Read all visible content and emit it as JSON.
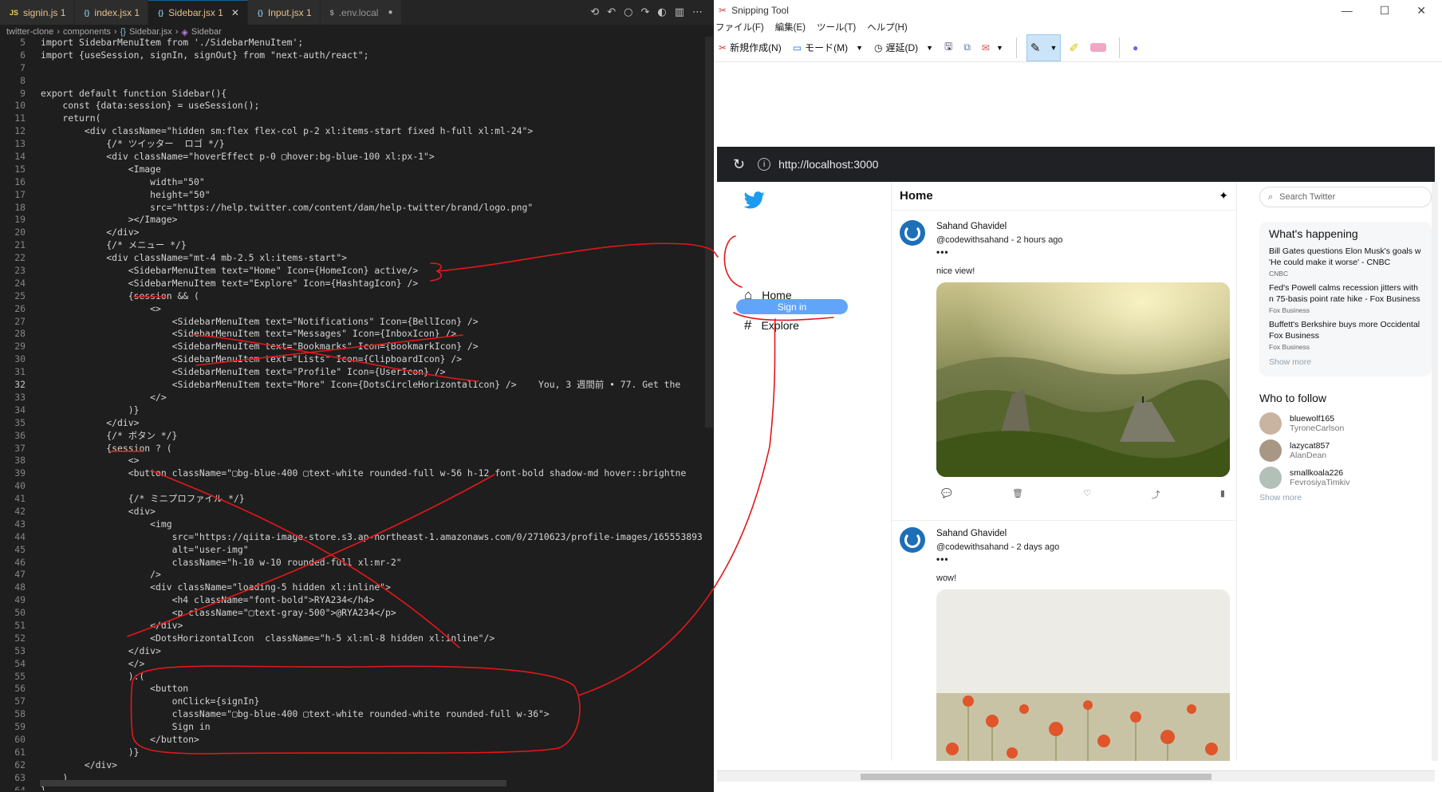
{
  "editor": {
    "tabs": [
      {
        "icon": "JS",
        "label": "signin.js 1"
      },
      {
        "icon": "{}",
        "label": "index.jsx 1"
      },
      {
        "icon": "{}",
        "label": "Sidebar.jsx 1",
        "active": true
      },
      {
        "icon": "{}",
        "label": "Input.jsx 1"
      },
      {
        "icon": "$",
        "label": ".env.local"
      }
    ],
    "breadcrumb": [
      "twitter-clone",
      "components",
      "Sidebar.jsx",
      "Sidebar"
    ],
    "lines": [
      {
        "n": "5",
        "t": "import SidebarMenuItem from './SidebarMenuItem';"
      },
      {
        "n": "6",
        "t": "import {useSession, signIn, signOut} from \"next-auth/react\";"
      },
      {
        "n": "7",
        "t": ""
      },
      {
        "n": "8",
        "t": ""
      },
      {
        "n": "9",
        "t": "export default function Sidebar(){"
      },
      {
        "n": "10",
        "t": "    const {data:session} = useSession();"
      },
      {
        "n": "11",
        "t": "    return("
      },
      {
        "n": "12",
        "t": "        <div className=\"hidden sm:flex flex-col p-2 xl:items-start fixed h-full xl:ml-24\">"
      },
      {
        "n": "13",
        "t": "            {/* ツイッター  ロゴ */}"
      },
      {
        "n": "14",
        "t": "            <div className=\"hoverEffect p-0 ▢hover:bg-blue-100 xl:px-1\">"
      },
      {
        "n": "15",
        "t": "                <Image"
      },
      {
        "n": "16",
        "t": "                    width=\"50\""
      },
      {
        "n": "17",
        "t": "                    height=\"50\""
      },
      {
        "n": "18",
        "t": "                    src=\"https://help.twitter.com/content/dam/help-twitter/brand/logo.png\""
      },
      {
        "n": "19",
        "t": "                ></Image>"
      },
      {
        "n": "20",
        "t": "            </div>"
      },
      {
        "n": "21",
        "t": "            {/* メニュー */}"
      },
      {
        "n": "22",
        "t": "            <div className=\"mt-4 mb-2.5 xl:items-start\">"
      },
      {
        "n": "23",
        "t": "                <SidebarMenuItem text=\"Home\" Icon={HomeIcon} active/>"
      },
      {
        "n": "24",
        "t": "                <SidebarMenuItem text=\"Explore\" Icon={HashtagIcon} />"
      },
      {
        "n": "25",
        "t": "                {session && ("
      },
      {
        "n": "26",
        "t": "                    <>"
      },
      {
        "n": "27",
        "t": "                        <SidebarMenuItem text=\"Notifications\" Icon={BellIcon} />"
      },
      {
        "n": "28",
        "t": "                        <SidebarMenuItem text=\"Messages\" Icon={InboxIcon} />"
      },
      {
        "n": "29",
        "t": "                        <SidebarMenuItem text=\"Bookmarks\" Icon={BookmarkIcon} />"
      },
      {
        "n": "30",
        "t": "                        <SidebarMenuItem text=\"Lists\" Icon={ClipboardIcon} />"
      },
      {
        "n": "31",
        "t": "                        <SidebarMenuItem text=\"Profile\" Icon={UserIcon} />"
      },
      {
        "n": "32",
        "t": "                        <SidebarMenuItem text=\"More\" Icon={DotsCircleHorizontalIcon} />    You, 3 週間前 • 77. Get the"
      },
      {
        "n": "33",
        "t": "                    </>"
      },
      {
        "n": "34",
        "t": "                )}"
      },
      {
        "n": "35",
        "t": "            </div>"
      },
      {
        "n": "36",
        "t": "            {/* ボタン */}"
      },
      {
        "n": "37",
        "t": "            {session ? ("
      },
      {
        "n": "38",
        "t": "                <>"
      },
      {
        "n": "39",
        "t": "                <button className=\"▢bg-blue-400 ▢text-white rounded-full w-56 h-12 font-bold shadow-md hover::brightne"
      },
      {
        "n": "40",
        "t": ""
      },
      {
        "n": "41",
        "t": "                {/* ミニプロファイル */}"
      },
      {
        "n": "42",
        "t": "                <div>"
      },
      {
        "n": "43",
        "t": "                    <img"
      },
      {
        "n": "44",
        "t": "                        src=\"https://qiita-image-store.s3.ap-northeast-1.amazonaws.com/0/2710623/profile-images/165553893"
      },
      {
        "n": "45",
        "t": "                        alt=\"user-img\""
      },
      {
        "n": "46",
        "t": "                        className=\"h-10 w-10 rounded-full xl:mr-2\""
      },
      {
        "n": "47",
        "t": "                    />"
      },
      {
        "n": "48",
        "t": "                    <div className=\"loading-5 hidden xl:inline\">"
      },
      {
        "n": "49",
        "t": "                        <h4 className=\"font-bold\">RYA234</h4>"
      },
      {
        "n": "50",
        "t": "                        <p className=\"▢text-gray-500\">@RYA234</p>"
      },
      {
        "n": "51",
        "t": "                    </div>"
      },
      {
        "n": "52",
        "t": "                    <DotsHorizontalIcon  className=\"h-5 xl:ml-8 hidden xl:inline\"/>"
      },
      {
        "n": "53",
        "t": "                </div>"
      },
      {
        "n": "54",
        "t": "                </>"
      },
      {
        "n": "55",
        "t": "                ):("
      },
      {
        "n": "56",
        "t": "                    <button"
      },
      {
        "n": "57",
        "t": "                        onClick={signIn}"
      },
      {
        "n": "58",
        "t": "                        className=\"▢bg-blue-400 ▢text-white rounded-white rounded-full w-36\">"
      },
      {
        "n": "59",
        "t": "                        Sign in"
      },
      {
        "n": "60",
        "t": "                    </button>"
      },
      {
        "n": "61",
        "t": "                )}"
      },
      {
        "n": "62",
        "t": "        </div>"
      },
      {
        "n": "63",
        "t": "    )"
      },
      {
        "n": "64",
        "t": "}"
      }
    ]
  },
  "snip": {
    "title": "Snipping Tool",
    "menu": [
      "ファイル(F)",
      "編集(E)",
      "ツール(T)",
      "ヘルプ(H)"
    ],
    "new_label": "新規作成(N)",
    "mode_label": "モード(M)",
    "delay_label": "遅延(D)"
  },
  "browser": {
    "url": "http://localhost:3000",
    "nav": [
      {
        "icon": "home-icon",
        "label": "Home"
      },
      {
        "icon": "hashtag-icon",
        "label": "Explore"
      }
    ],
    "signin": "Sign in",
    "feed_title": "Home",
    "posts": [
      {
        "name": "Sahand Ghavidel",
        "handle": "@codewithsahand - 2 hours ago",
        "text": "nice view!"
      },
      {
        "name": "Sahand Ghavidel",
        "handle": "@codewithsahand - 2 days ago",
        "text": "wow!"
      }
    ],
    "search_placeholder": "Search Twitter",
    "happening_title": "What's happening",
    "news": [
      {
        "headline": "Bill Gates questions Elon Musk's goals w 'He could make it worse' - CNBC",
        "source": "CNBC"
      },
      {
        "headline": "Fed's Powell calms recession jitters with n 75-basis point rate hike - Fox Business",
        "source": "Fox Business"
      },
      {
        "headline": "Buffett's Berkshire buys more Occidental Fox Business",
        "source": "Fox Business"
      }
    ],
    "show_more": "Show more",
    "follow_title": "Who to follow",
    "follow": [
      {
        "user": "bluewolf165",
        "name": "TyroneCarlson"
      },
      {
        "user": "lazycat857",
        "name": "AlanDean"
      },
      {
        "user": "smallkoala226",
        "name": "FevrosiyaTimkiv"
      }
    ],
    "show_more2": "Show more"
  }
}
